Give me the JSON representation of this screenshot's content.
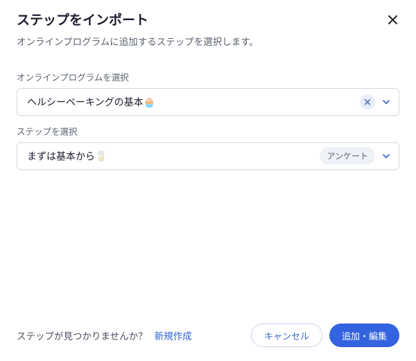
{
  "header": {
    "title": "ステップをインポート",
    "subtitle": "オンラインプログラムに追加するステップを選択します。"
  },
  "program": {
    "label": "オンラインプログラムを選択",
    "value": "ヘルシーベーキングの基本🧁"
  },
  "step": {
    "label": "ステップを選択",
    "value": "まずは基本から🥛",
    "badge": "アンケート"
  },
  "footer": {
    "prompt": "ステップが見つかりませんか？",
    "create_link": "新規作成",
    "cancel": "キャンセル",
    "submit": "追加・編集"
  }
}
